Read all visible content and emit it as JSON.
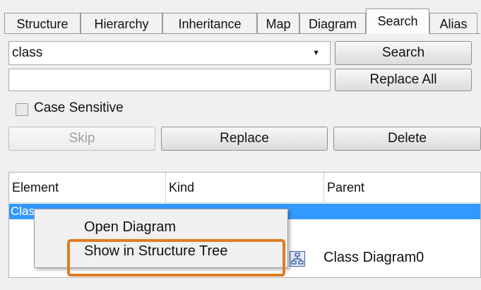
{
  "tabs": [
    "Structure",
    "Hierarchy",
    "Inheritance",
    "Map",
    "Diagram",
    "Search",
    "Alias"
  ],
  "active_tab": "Search",
  "search": {
    "query": "class",
    "replace_value": "",
    "search_button": "Search",
    "replace_all_button": "Replace All",
    "case_sensitive_label": "Case Sensitive",
    "case_sensitive_checked": false,
    "skip_button": "Skip",
    "replace_button": "Replace",
    "delete_button": "Delete"
  },
  "results": {
    "columns": [
      "Element",
      "Kind",
      "Parent"
    ],
    "selected_row": {
      "element": "Clas",
      "kind": "",
      "parent": ""
    }
  },
  "context_menu": {
    "items": [
      "Open Diagram",
      "Show in Structure Tree"
    ],
    "highlighted_item": "Show in Structure Tree",
    "highlight_color": "#e07b25"
  },
  "background_item": {
    "icon": "class-diagram-icon",
    "label": "Class Diagram0"
  },
  "colors": {
    "selection": "#3399ff",
    "highlight": "#e07b25"
  }
}
